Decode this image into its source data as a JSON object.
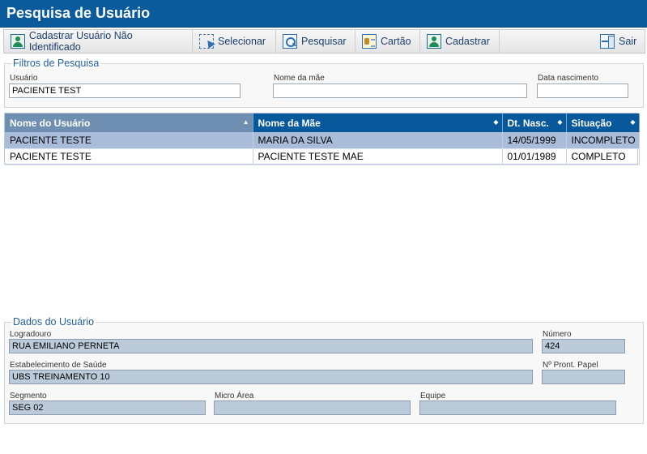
{
  "header": {
    "title": "Pesquisa de Usuário"
  },
  "toolbar": {
    "buttons": [
      {
        "label": "Cadastrar Usuário Não Identificado",
        "icon": "user-icon"
      },
      {
        "label": "Selecionar",
        "icon": "select-icon"
      },
      {
        "label": "Pesquisar",
        "icon": "search-icon"
      },
      {
        "label": "Cartão",
        "icon": "card-icon"
      },
      {
        "label": "Cadastrar",
        "icon": "user-icon"
      }
    ],
    "exit_label": "Sair"
  },
  "filters": {
    "legend": "Filtros de Pesquisa",
    "usuario_label": "Usuário",
    "usuario_value": "PACIENTE TEST",
    "mae_label": "Nome da mãe",
    "mae_value": "",
    "nasc_label": "Data nascimento",
    "nasc_value": ""
  },
  "grid": {
    "columns": [
      "Nome do Usuário",
      "Nome da Mãe",
      "Dt. Nasc.",
      "Situação"
    ],
    "rows": [
      [
        "PACIENTE TESTE",
        "MARIA DA SILVA",
        "14/05/1999",
        "INCOMPLETO"
      ],
      [
        "PACIENTE TESTE",
        "PACIENTE TESTE MAE",
        "01/01/1989",
        "COMPLETO"
      ]
    ]
  },
  "details": {
    "legend": "Dados do Usuário",
    "logradouro_label": "Logradouro",
    "logradouro_value": "RUA EMILIANO PERNETA",
    "numero_label": "Número",
    "numero_value": "424",
    "estab_label": "Estabelecimento de Saúde",
    "estab_value": "UBS TREINAMENTO 10",
    "pront_label": "Nº Pront. Papel",
    "pront_value": "",
    "segmento_label": "Segmento",
    "segmento_value": "SEG 02",
    "microarea_label": "Micro Área",
    "microarea_value": "",
    "equipe_label": "Equipe",
    "equipe_value": ""
  },
  "colors": {
    "title_bar": "#0a5a9c",
    "header_row": "#07599c",
    "selected_row": "#a9bddb",
    "legend_text": "#1f5f9e"
  }
}
